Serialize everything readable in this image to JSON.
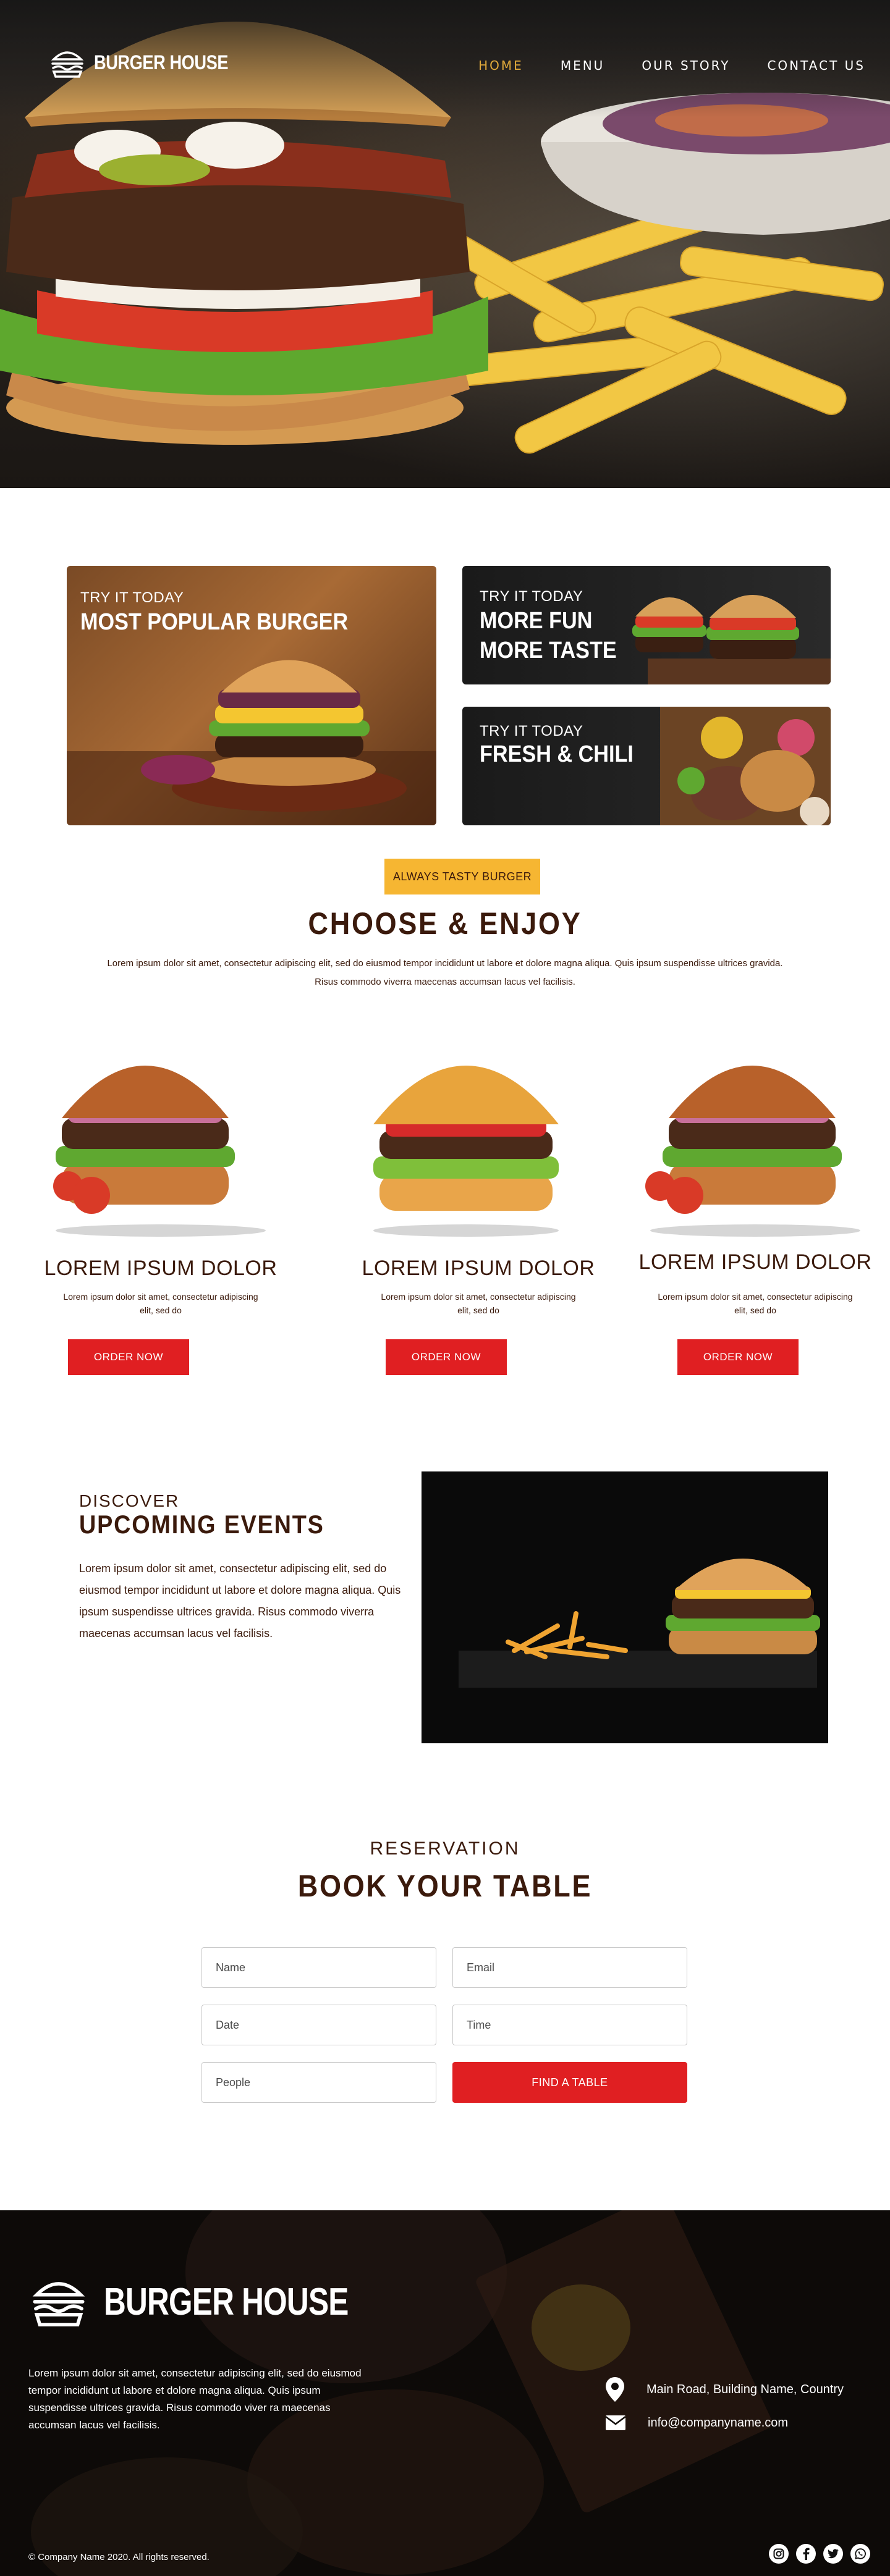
{
  "brand": {
    "name": "BURGER HOUSE"
  },
  "nav": {
    "items": [
      "HOME",
      "MENU",
      "OUR STORY",
      "CONTACT US"
    ],
    "active": "HOME"
  },
  "promos": {
    "big": {
      "kicker": "TRY IT TODAY",
      "title": "MOST POPULAR BURGER"
    },
    "small1": {
      "kicker": "TRY IT TODAY",
      "title_line1": "MORE FUN",
      "title_line2": "MORE TASTE"
    },
    "small2": {
      "kicker": "TRY IT TODAY",
      "title": "FRESH & CHILI"
    }
  },
  "choose": {
    "badge": "ALWAYS TASTY BURGER",
    "title": "CHOOSE & ENJOY",
    "lead": "Lorem ipsum dolor sit amet, consectetur adipiscing elit, sed do eiusmod tempor incididunt ut labore et dolore magna aliqua. Quis ipsum suspendisse ultrices gravida. Risus commodo viverra maecenas accumsan lacus vel facilisis."
  },
  "products": [
    {
      "name": "LOREM IPSUM DOLOR",
      "desc_line1": "Lorem ipsum dolor sit amet, consectetur adipiscing",
      "desc_line2": "elit, sed do",
      "button": "ORDER NOW"
    },
    {
      "name": "LOREM IPSUM DOLOR",
      "desc_line1": "Lorem ipsum dolor sit amet, consectetur adipiscing",
      "desc_line2": "elit, sed do",
      "button": "ORDER NOW"
    },
    {
      "name": "LOREM IPSUM DOLOR",
      "desc_line1": "Lorem ipsum dolor sit amet, consectetur adipiscing",
      "desc_line2": "elit, sed do",
      "button": "ORDER NOW"
    }
  ],
  "events": {
    "kicker": "DISCOVER",
    "title": "UPCOMING EVENTS",
    "text": "Lorem ipsum dolor sit amet, consectetur adipiscing elit, sed do eiusmod tempor incididunt ut labore et dolore magna aliqua. Quis ipsum suspendisse ultrices gravida. Risus commodo viverra maecenas accumsan lacus vel facilisis."
  },
  "reservation": {
    "kicker": "RESERVATION",
    "title": "BOOK YOUR TABLE",
    "placeholders": {
      "name": "Name",
      "email": "Email",
      "date": "Date",
      "time": "Time",
      "people": "People"
    },
    "button": "FIND A TABLE"
  },
  "footer": {
    "brand": "BURGER HOUSE",
    "text": "Lorem ipsum dolor sit amet, consectetur adipiscing elit, sed do eiusmod tempor incididunt ut labore et dolore magna aliqua. Quis ipsum suspendisse ultrices gravida. Risus commodo viver ra maecenas accumsan lacus vel facilisis.",
    "address": "Main Road, Building Name, Country",
    "email": "info@companyname.com",
    "copyright": "© Company Name 2020. All rights reserved."
  },
  "colors": {
    "accent_red": "#e01f22",
    "accent_yellow": "#f6b632",
    "brown_text": "#3b1a0c",
    "nav_active": "#e0a93a"
  },
  "icons": {
    "logo": "burger-icon",
    "location": "map-pin-icon",
    "mail": "envelope-icon",
    "social": [
      "instagram-icon",
      "facebook-icon",
      "twitter-icon",
      "whatsapp-icon"
    ]
  }
}
